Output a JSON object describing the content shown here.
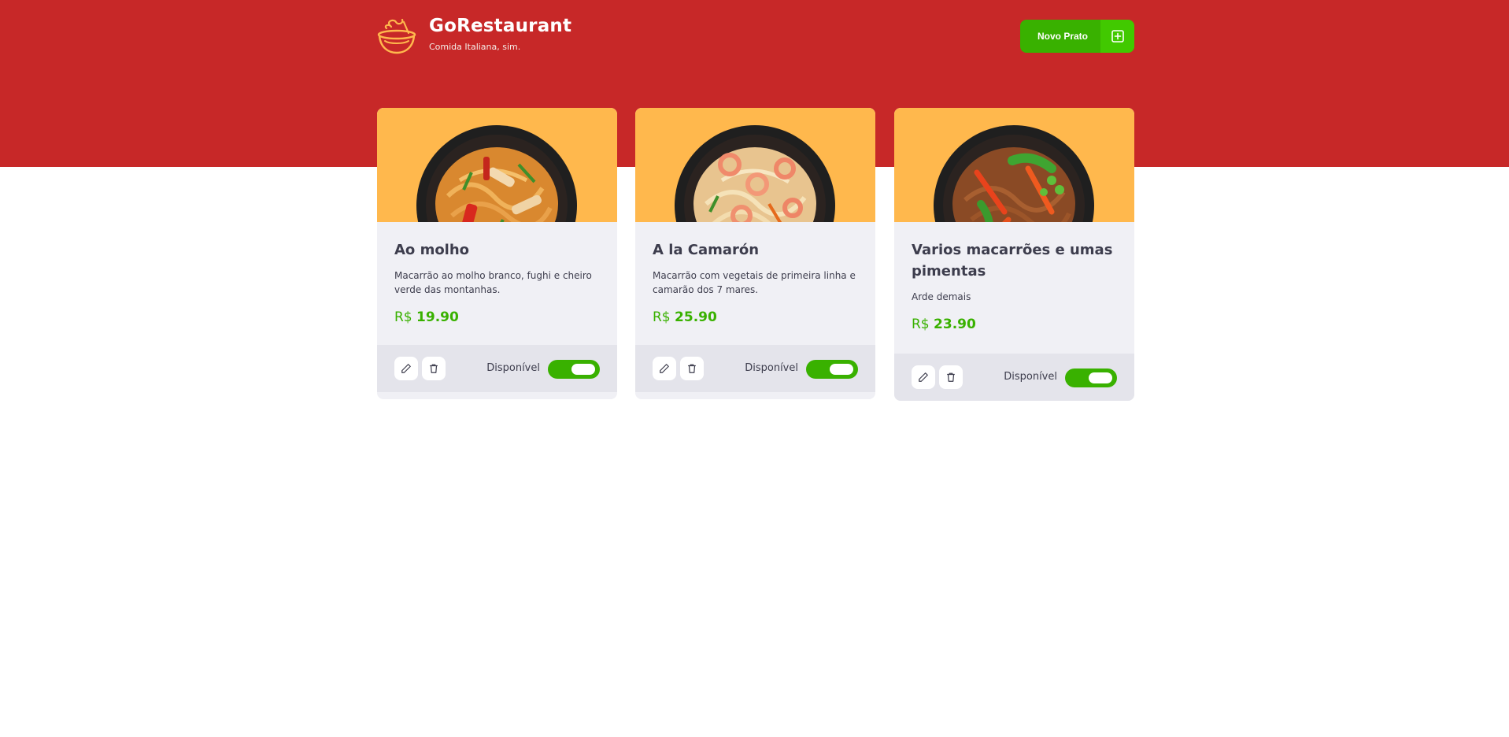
{
  "app": {
    "title": "GoRestaurant",
    "subtitle": "Comida Italiana, sim."
  },
  "header": {
    "new_button_label": "Novo Prato",
    "new_button_icon": "plus-square-icon"
  },
  "colors": {
    "brand_red": "#c72828",
    "accent_green": "#39b100",
    "accent_green_light": "#41c900",
    "image_bg": "#ffb84d",
    "logo_orange": "#ffb84d"
  },
  "dishes": [
    {
      "name": "Ao molho",
      "description": "Macarrão ao molho branco, fughi e cheiro verde das montanhas.",
      "currency": "R$",
      "price": "19.90",
      "available_label": "Disponível",
      "available": true,
      "edit_icon": "pencil-icon",
      "delete_icon": "trash-icon"
    },
    {
      "name": "A la Camarón",
      "description": "Macarrão com vegetais de primeira linha e camarão dos 7 mares.",
      "currency": "R$",
      "price": "25.90",
      "available_label": "Disponível",
      "available": true,
      "edit_icon": "pencil-icon",
      "delete_icon": "trash-icon"
    },
    {
      "name": "Varios macarrões e umas pimentas",
      "description": "Arde demais",
      "currency": "R$",
      "price": "23.90",
      "available_label": "Disponível",
      "available": true,
      "edit_icon": "pencil-icon",
      "delete_icon": "trash-icon"
    }
  ]
}
